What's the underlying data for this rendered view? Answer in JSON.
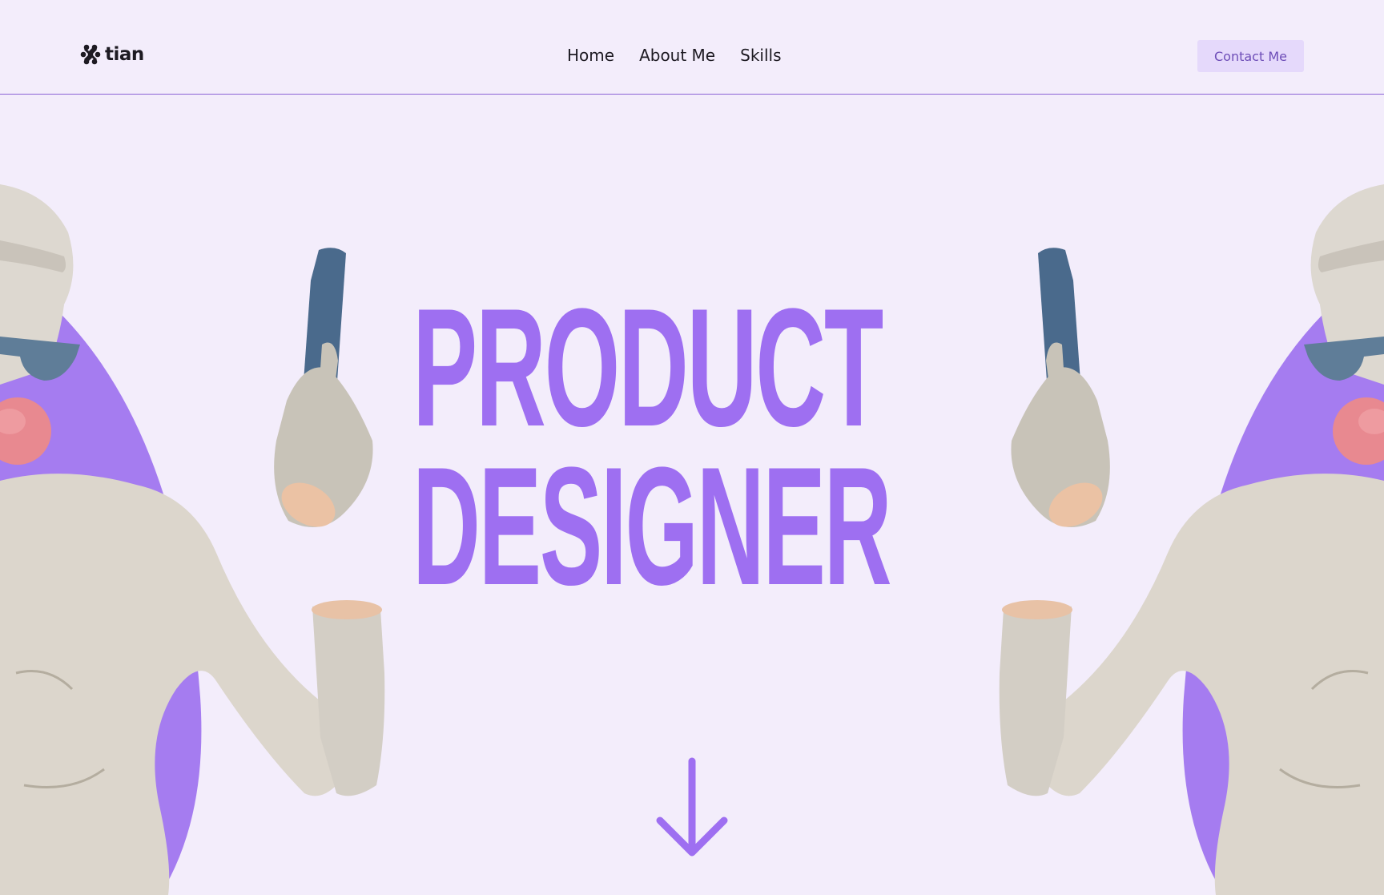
{
  "brand": {
    "name": "tian",
    "accent": "#9e6ff1",
    "background": "#f3edfb"
  },
  "nav": {
    "items": [
      {
        "label": "Home"
      },
      {
        "label": "About Me"
      },
      {
        "label": "Skills"
      }
    ]
  },
  "header": {
    "contact_label": "Contact Me"
  },
  "hero": {
    "title_line1": "PRODUCT",
    "title_line2": "DESIGNER"
  },
  "icons": {
    "logo": "logo-mark-icon",
    "scroll": "arrow-down-icon"
  }
}
